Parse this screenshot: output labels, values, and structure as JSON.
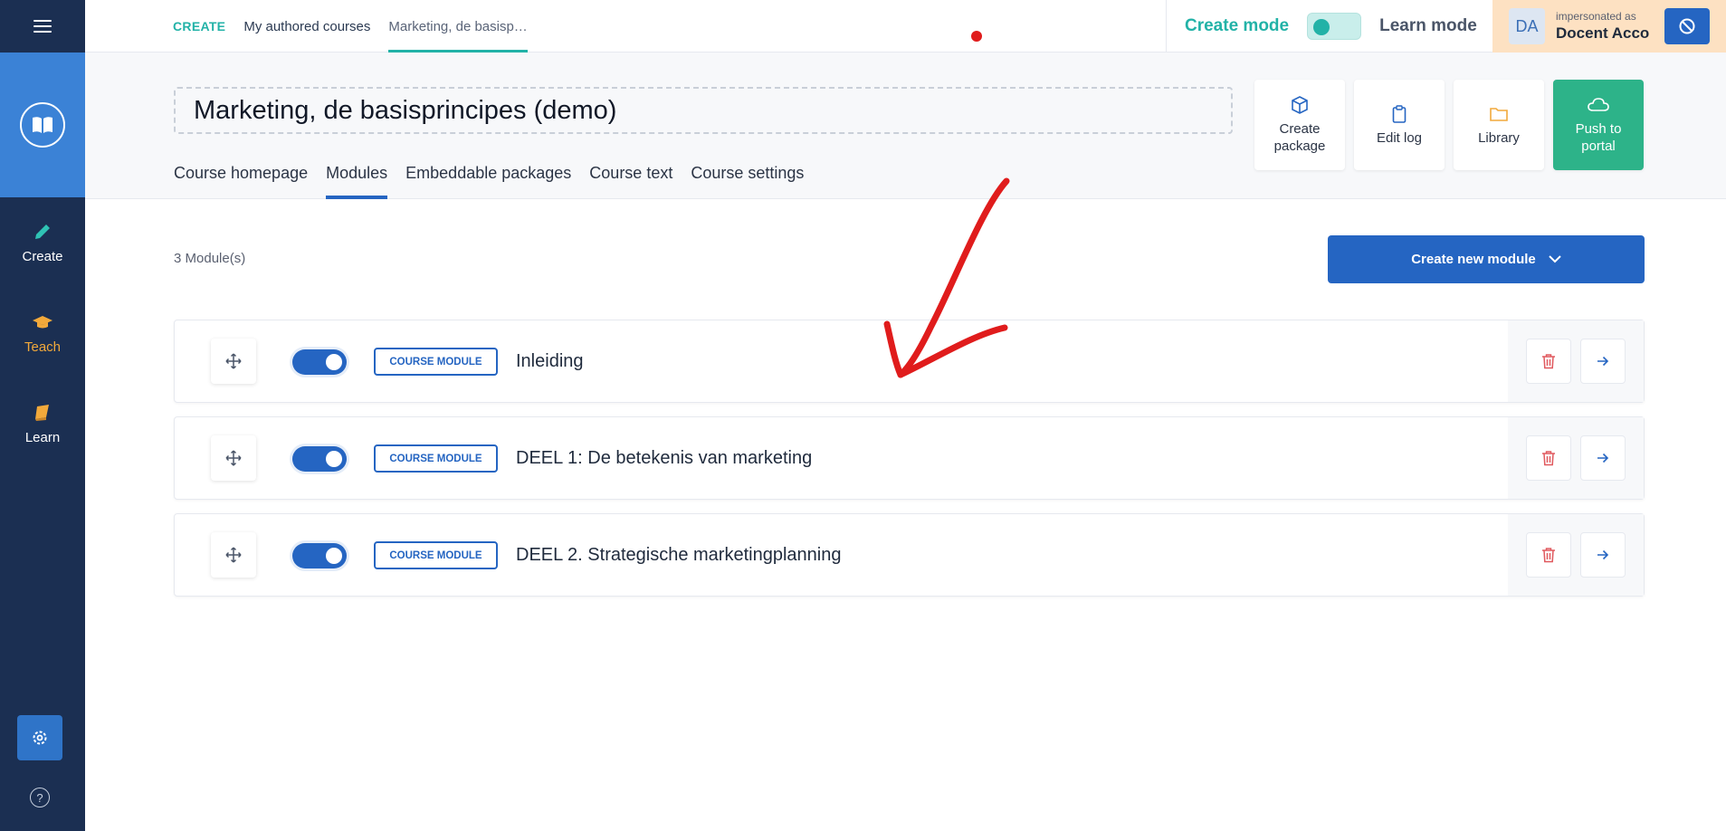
{
  "sidebar": {
    "items": [
      {
        "label": "Create",
        "icon": "pencil-icon"
      },
      {
        "label": "Teach",
        "icon": "graduation-cap-icon"
      },
      {
        "label": "Learn",
        "icon": "book-icon"
      }
    ],
    "help_symbol": "?"
  },
  "topbar": {
    "crumbs": [
      "CREATE",
      "My authored courses",
      "Marketing, de basisp…"
    ],
    "create_mode": "Create mode",
    "learn_mode": "Learn mode",
    "avatar_initials": "DA",
    "impersonated_label": "impersonated as",
    "impersonated_name": "Docent Acco"
  },
  "header": {
    "course_title": "Marketing, de basisprincipes (demo)",
    "tabs": [
      "Course homepage",
      "Modules",
      "Embeddable packages",
      "Course text",
      "Course settings"
    ],
    "actions": {
      "create_package": [
        "Create",
        "package"
      ],
      "edit_log": "Edit log",
      "library": "Library",
      "push_portal": [
        "Push to",
        "portal"
      ]
    }
  },
  "main": {
    "module_count": "3 Module(s)",
    "create_new_module": "Create new module",
    "modules": [
      {
        "badge": "COURSE MODULE",
        "title": "Inleiding",
        "enabled": true
      },
      {
        "badge": "COURSE MODULE",
        "title": "DEEL 1: De betekenis van marketing",
        "enabled": true
      },
      {
        "badge": "COURSE MODULE",
        "title": "DEEL 2. Strategische marketingplanning",
        "enabled": true
      }
    ]
  },
  "colors": {
    "sidebar": "#1b2f52",
    "primary": "#2565c2",
    "teal": "#22b2a7",
    "push": "#2db389",
    "annotation": "#e01c1c"
  }
}
